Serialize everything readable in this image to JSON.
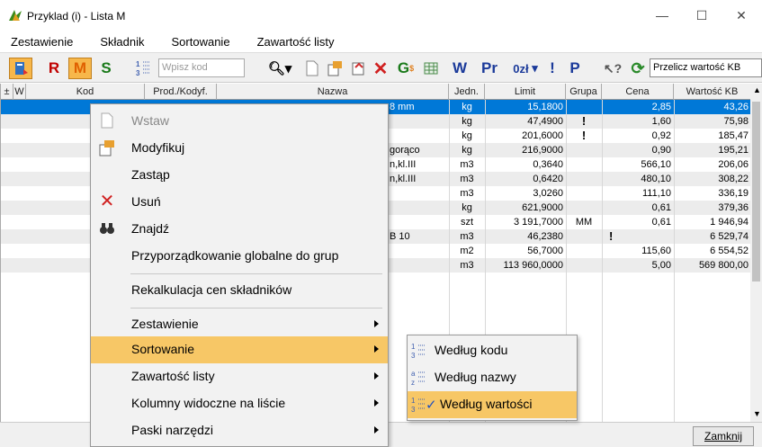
{
  "window": {
    "title": "Przyklad (i) - Lista M",
    "minimize": "—",
    "maximize": "☐",
    "close": "✕"
  },
  "menu": {
    "items": [
      "Zestawienie",
      "Składnik",
      "Sortowanie",
      "Zawartość listy"
    ]
  },
  "toolbar": {
    "r": "R",
    "m": "M",
    "s": "S",
    "search_placeholder": "Wpisz kod",
    "w": "W",
    "pr": "Pr",
    "zero": "0zł",
    "excl": "!",
    "p": "P",
    "recalc_label": "Przelicz wartość KB",
    "colors": {
      "r": "#c00000",
      "m": "#e06000",
      "s": "#1a7a1a",
      "highlight": "#f7b74a"
    }
  },
  "grid": {
    "headers": [
      "±",
      "W",
      "Kod",
      "Prod./Kodyf.",
      "Nazwa",
      "Jedn.",
      "Limit",
      "Grupa",
      "Cena",
      "Wartość KB"
    ],
    "rows": [
      {
        "nazwa": "8 mm",
        "jedn": "kg",
        "limit": "15,1800",
        "grupa": "",
        "cena": "2,85",
        "wartosc": "43,26",
        "cena_flag": ""
      },
      {
        "nazwa": "",
        "jedn": "kg",
        "limit": "47,4900",
        "grupa": "!",
        "cena": "1,60",
        "wartosc": "75,98",
        "cena_flag": ""
      },
      {
        "nazwa": "",
        "jedn": "kg",
        "limit": "201,6000",
        "grupa": "!",
        "cena": "0,92",
        "wartosc": "185,47",
        "cena_flag": ""
      },
      {
        "nazwa": "gorąco",
        "jedn": "kg",
        "limit": "216,9000",
        "grupa": "",
        "cena": "0,90",
        "wartosc": "195,21",
        "cena_flag": ""
      },
      {
        "nazwa": "n,kl.III",
        "jedn": "m3",
        "limit": "0,3640",
        "grupa": "",
        "cena": "566,10",
        "wartosc": "206,06",
        "cena_flag": ""
      },
      {
        "nazwa": "n,kl.III",
        "jedn": "m3",
        "limit": "0,6420",
        "grupa": "",
        "cena": "480,10",
        "wartosc": "308,22",
        "cena_flag": ""
      },
      {
        "nazwa": "",
        "jedn": "m3",
        "limit": "3,0260",
        "grupa": "",
        "cena": "111,10",
        "wartosc": "336,19",
        "cena_flag": ""
      },
      {
        "nazwa": "",
        "jedn": "kg",
        "limit": "621,9000",
        "grupa": "",
        "cena": "0,61",
        "wartosc": "379,36",
        "cena_flag": ""
      },
      {
        "nazwa": "",
        "jedn": "szt",
        "limit": "3 191,7000",
        "grupa": "MM",
        "cena": "0,61",
        "wartosc": "1 946,94",
        "cena_flag": ""
      },
      {
        "nazwa": "B 10",
        "jedn": "m3",
        "limit": "46,2380",
        "grupa": "",
        "cena": "",
        "wartosc": "6 529,74",
        "cena_flag": "!"
      },
      {
        "nazwa": "",
        "jedn": "m2",
        "limit": "56,7000",
        "grupa": "",
        "cena": "115,60",
        "wartosc": "6 554,52",
        "cena_flag": ""
      },
      {
        "nazwa": "",
        "jedn": "m3",
        "limit": "113 960,0000",
        "grupa": "",
        "cena": "5,00",
        "wartosc": "569 800,00",
        "cena_flag": ""
      }
    ]
  },
  "context_menu": {
    "insert": "Wstaw",
    "modify": "Modyfikuj",
    "replace": "Zastąp",
    "delete": "Usuń",
    "find": "Znajdź",
    "assign_groups": "Przyporządkowanie globalne do grup",
    "recalc_prices": "Rekalkulacja cen składników",
    "statement": "Zestawienie",
    "sorting": "Sortowanie",
    "list_content": "Zawartość listy",
    "visible_columns": "Kolumny widoczne na liście",
    "toolbars": "Paski narzędzi"
  },
  "submenu": {
    "by_code": "Według kodu",
    "by_name": "Według nazwy",
    "by_value": "Według wartości"
  },
  "footer": {
    "close_button": "Zamknij"
  }
}
